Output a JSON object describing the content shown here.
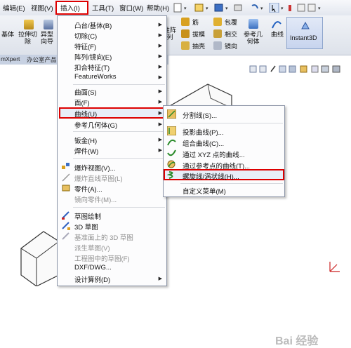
{
  "menubar": {
    "items": [
      "编辑(E)",
      "视图(V)",
      "插入(I)",
      "工具(T)",
      "窗口(W)",
      "帮助(H)"
    ]
  },
  "toolbar": {
    "left_labels": [
      "基体",
      "拉伸切\n除",
      "异型\n向导"
    ],
    "right_small": [
      "筋",
      "拔模",
      "抽壳",
      "包覆",
      "相交",
      "镜向"
    ],
    "ref_geom": "参考几\n何体",
    "curves": "曲线",
    "instant3d": "Instant3D",
    "array_partial": "性阵\n列"
  },
  "tabs": [
    "mXpert",
    "办公室产品"
  ],
  "insert_menu": {
    "items": [
      {
        "label": "凸台/基体(B)",
        "arrow": true
      },
      {
        "label": "切除(C)",
        "arrow": true
      },
      {
        "label": "特征(F)",
        "arrow": true
      },
      {
        "label": "阵列/镜向(E)",
        "arrow": true
      },
      {
        "label": "扣合特征(T)",
        "arrow": true
      },
      {
        "label": "FeatureWorks",
        "arrow": true
      },
      {
        "label": "曲面(S)",
        "arrow": true
      },
      {
        "label": "面(F)",
        "arrow": true
      },
      {
        "label": "曲线(U)",
        "arrow": true
      },
      {
        "label": "参考几何体(G)",
        "arrow": true
      },
      {
        "label": "钣金(H)",
        "arrow": true
      },
      {
        "label": "焊件(W)",
        "arrow": true
      },
      {
        "label": "爆炸视图(V)...",
        "arrow": false
      },
      {
        "label": "爆炸直线草图(L)",
        "arrow": false
      },
      {
        "label": "零件(A)...",
        "arrow": false
      },
      {
        "label": "镜向零件(M)...",
        "arrow": false
      },
      {
        "label": "草图绘制",
        "arrow": false
      },
      {
        "label": "3D 草图",
        "arrow": false
      },
      {
        "label": "基准面上的 3D 草图",
        "arrow": false
      },
      {
        "label": "派生草图(V)",
        "arrow": false
      },
      {
        "label": "工程图中的草图(F)",
        "arrow": false
      },
      {
        "label": "DXF/DWG...",
        "arrow": false
      },
      {
        "label": "设计算例(D)",
        "arrow": true
      }
    ]
  },
  "curve_submenu": {
    "items": [
      {
        "label": "分割线(S)..."
      },
      {
        "label": "投影曲线(P)..."
      },
      {
        "label": "组合曲线(C)..."
      },
      {
        "label": "通过 XYZ 点的曲线..."
      },
      {
        "label": "通过参考点的曲线(T)..."
      },
      {
        "label": "螺旋线/涡状线(H)..."
      },
      {
        "label": "自定义菜单(M)"
      }
    ]
  },
  "watermark": "Bai 经验",
  "colors": {
    "highlight_border": "#dd0000",
    "menu_bg": "#fcfcfd"
  }
}
